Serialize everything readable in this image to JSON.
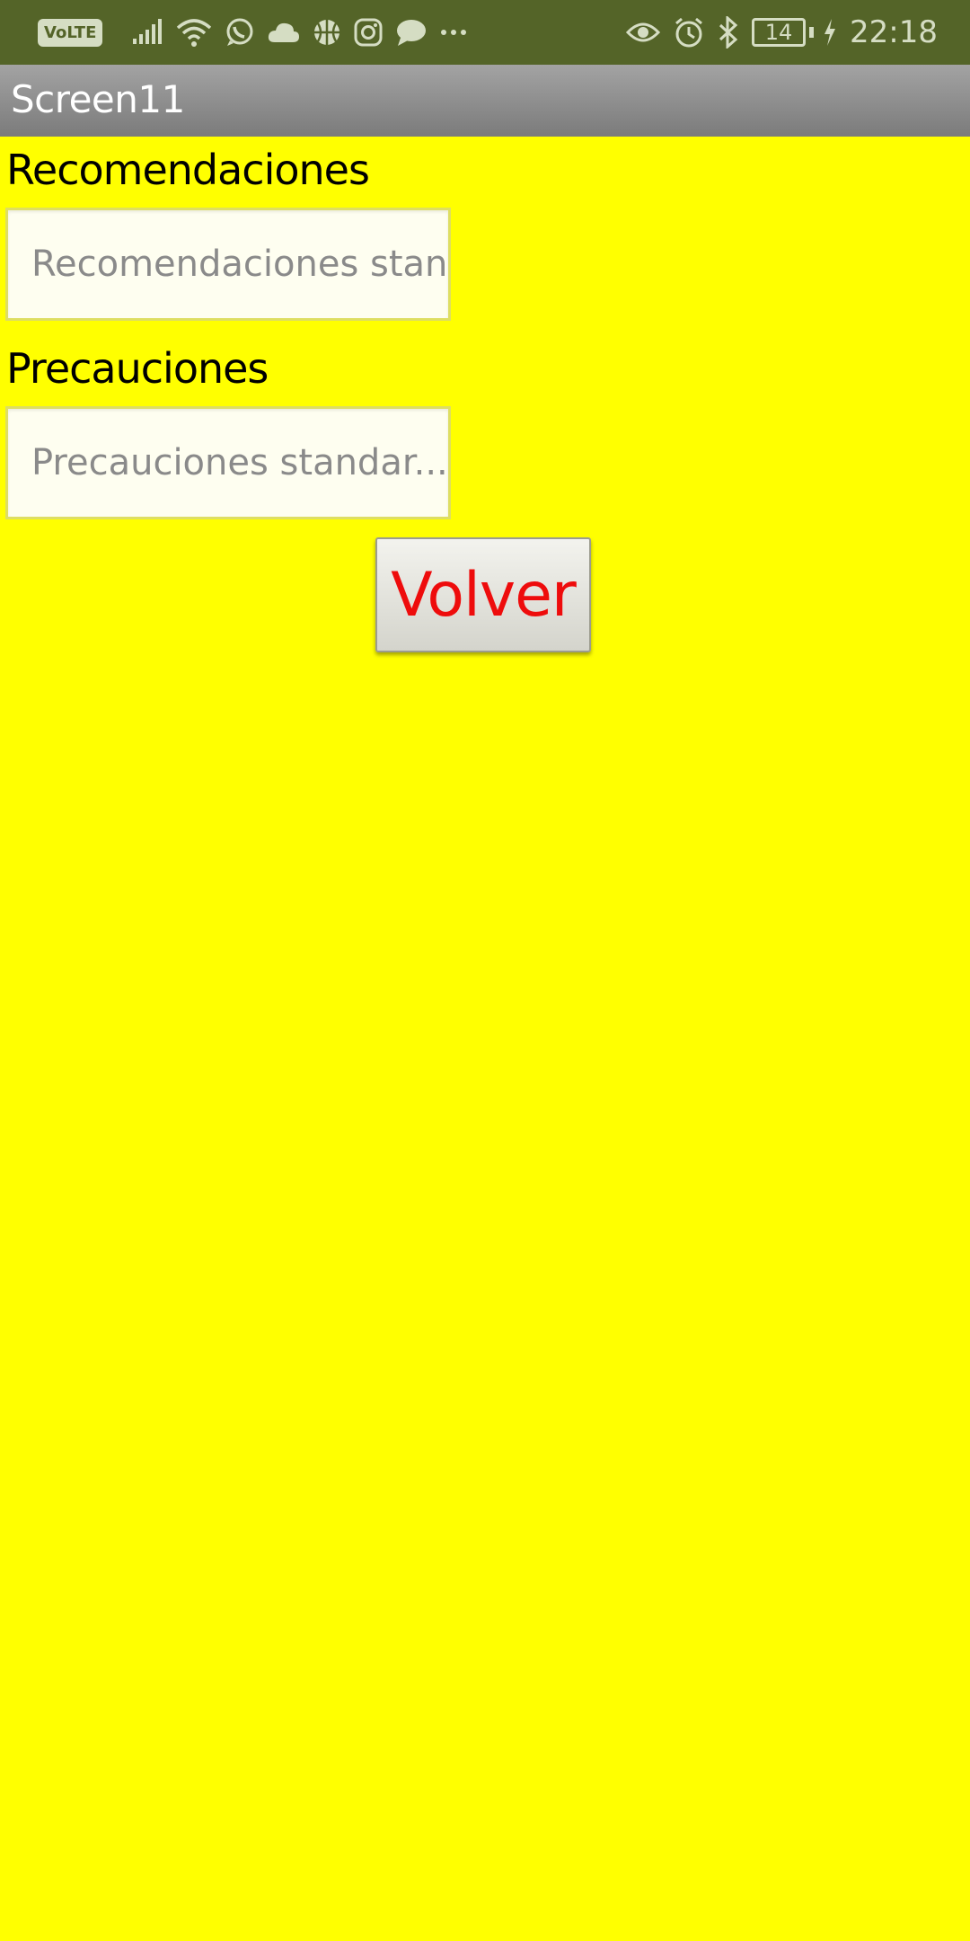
{
  "status_bar": {
    "network_badge": "VoLTE",
    "left_icons": [
      "signal-icon",
      "wifi-icon",
      "whatsapp-icon",
      "cloud-icon",
      "basketball-icon",
      "instagram-icon",
      "message-icon",
      "more-icon"
    ],
    "right_icons": [
      "eye-icon",
      "alarm-icon",
      "bluetooth-icon"
    ],
    "battery_level": "14",
    "time": "22:18",
    "background": "#546428"
  },
  "title_bar": {
    "title": "Screen11"
  },
  "form": {
    "recomendaciones_label": "Recomendaciones",
    "recomendaciones_placeholder": "Recomendaciones standar...",
    "precauciones_label": "Precauciones",
    "precauciones_placeholder": "Precauciones standar...",
    "volver_label": "Volver"
  },
  "colors": {
    "background": "#ffff00",
    "button_text": "#ee0c0c",
    "textbox_background": "#fefef0"
  }
}
